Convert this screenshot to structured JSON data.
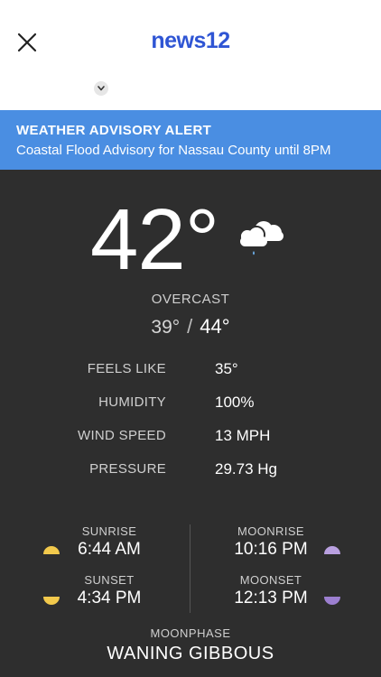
{
  "header": {
    "logo_text": "news12",
    "brand_color": "#2f55d4"
  },
  "advisory": {
    "title": "WEATHER ADVISORY ALERT",
    "text": "Coastal Flood Advisory for Nassau County until 8PM",
    "bg_color": "#4a8ee2"
  },
  "current": {
    "temperature": "42°",
    "condition": "OVERCAST",
    "condition_icon": "cloud-drizzle-icon",
    "low": "39°",
    "separator": "/",
    "high": "44°"
  },
  "stats": [
    {
      "label": "FEELS LIKE",
      "value": "35°"
    },
    {
      "label": "HUMIDITY",
      "value": "100%"
    },
    {
      "label": "WIND SPEED",
      "value": "13 MPH"
    },
    {
      "label": "PRESSURE",
      "value": "29.73 Hg"
    }
  ],
  "sun": {
    "sunrise_label": "SUNRISE",
    "sunrise_time": "6:44 AM",
    "sunset_label": "SUNSET",
    "sunset_time": "4:34 PM",
    "color": "#f2c94c"
  },
  "moon": {
    "moonrise_label": "MOONRISE",
    "moonrise_time": "10:16 PM",
    "moonset_label": "MOONSET",
    "moonset_time": "12:13 PM",
    "color": "#b9a0e0",
    "phase_label": "MOONPHASE",
    "phase_value": "WANING GIBBOUS"
  }
}
